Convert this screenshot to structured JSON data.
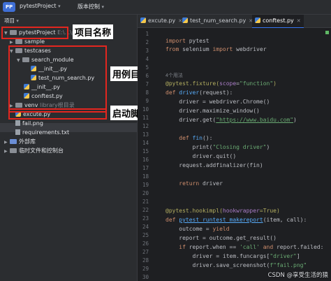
{
  "titlebar": {
    "badge": "PP",
    "project": "pytestProject",
    "vcs": "版本控制"
  },
  "panel": {
    "title": "项目"
  },
  "tree": {
    "root": "pytestProject",
    "root_path": "E:\\...\\pytestProject",
    "sample": "sample",
    "testcases": "testcases",
    "search_module": "search_module",
    "init1": "__init__.py",
    "test_num_search": "test_num_search.py",
    "init2": "__init__.py",
    "conftest": "conftest.py",
    "venv": "venv",
    "venv_hint": "library根目录",
    "excute": "excute.py",
    "failpng": "fail.png",
    "requirements": "requirements.txt",
    "external": "外部库",
    "scratch": "临时文件和控制台"
  },
  "annotations": {
    "project_name": "项目名称",
    "case_dir": "用例目录",
    "launch_script": "启动脚本"
  },
  "tabs": [
    {
      "label": "excute.py",
      "active": false
    },
    {
      "label": "test_num_search.py",
      "active": false
    },
    {
      "label": "conftest.py",
      "active": true
    }
  ],
  "gutter": [
    "1",
    "2",
    "3",
    "4",
    "5",
    "6",
    "7",
    "8",
    "9",
    "10",
    "11",
    "12",
    "13",
    "14",
    "15",
    "16",
    "17",
    "18",
    "19",
    "20",
    "21",
    "22",
    "23",
    "24",
    "25",
    "26",
    "27",
    "28",
    "29",
    "30"
  ],
  "code": {
    "usages": "4个用法",
    "l1k": "import",
    "l1r": " pytest",
    "l2a": "from",
    "l2b": " selenium ",
    "l2c": "import",
    "l2d": " webdriver",
    "l3a": "@pytest.fixture(",
    "l3b": "scope",
    "l3c": "=",
    "l3d": "\"function\"",
    "l3e": ")",
    "l4a": "def ",
    "l4b": "driver",
    "l4c": "(request):",
    "l5": "    driver = webdriver.Chrome()",
    "l6": "    driver.maximize_window()",
    "l7a": "    driver.get(",
    "l7b": "\"https://www.baidu.com\"",
    "l7c": ")",
    "l8a": "    def ",
    "l8b": "fin",
    "l8c": "():",
    "l9a": "        print(",
    "l9b": "\"Closing driver\"",
    "l9c": ")",
    "l10": "        driver.quit()",
    "l11": "    request.addfinalizer(fin)",
    "l12a": "    return",
    "l12b": " driver",
    "l13a": "@pytest.hookimpl(",
    "l13b": "hookwrapper",
    "l13c": "=True)",
    "l14a": "def ",
    "l14b": "pytest_runtest_makereport",
    "l14c": "(item, call):",
    "l15a": "    outcome = ",
    "l15b": "yield",
    "l16": "    report = outcome.get_result()",
    "l17a": "    if ",
    "l17b": "report.when == ",
    "l17c": "'call'",
    "l17d": " and ",
    "l17e": "report.failed:",
    "l18a": "        driver = item.funcargs[",
    "l18b": "\"driver\"",
    "l18c": "]",
    "l19a": "        driver.save_screenshot(",
    "l19b": "f\"fail.png\""
  },
  "watermark": "CSDN @享受生活的猿"
}
